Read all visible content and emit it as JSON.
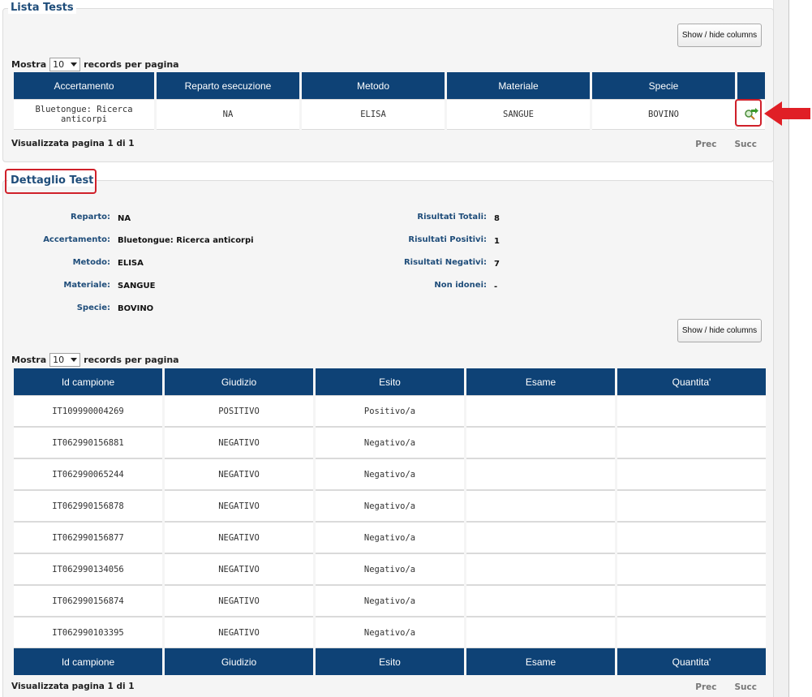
{
  "lista": {
    "title": "Lista Tests",
    "show_hide_label": "Show / hide columns",
    "length": {
      "prefix": "Mostra",
      "value": "10",
      "suffix": "records per pagina"
    },
    "columns": [
      "Accertamento",
      "Reparto esecuzione",
      "Metodo",
      "Materiale",
      "Specie",
      ""
    ],
    "rows": [
      {
        "accertamento": "Bluetongue: Ricerca anticorpi",
        "reparto": "NA",
        "metodo": "ELISA",
        "materiale": "SANGUE",
        "specie": "BOVINO",
        "action_icon": "view-details-icon"
      }
    ],
    "info": "Visualizzata pagina 1 di 1",
    "prev": "Prec",
    "next": "Succ"
  },
  "dettaglio": {
    "title": "Dettaglio Test",
    "fields_left": [
      {
        "label": "Reparto:",
        "value": "NA"
      },
      {
        "label": "Accertamento:",
        "value": "Bluetongue: Ricerca anticorpi"
      },
      {
        "label": "Metodo:",
        "value": "ELISA"
      },
      {
        "label": "Materiale:",
        "value": "SANGUE"
      },
      {
        "label": "Specie:",
        "value": "BOVINO"
      }
    ],
    "fields_right": [
      {
        "label": "Risultati Totali:",
        "value": "8"
      },
      {
        "label": "Risultati Positivi:",
        "value": "1"
      },
      {
        "label": "Risultati Negativi:",
        "value": "7"
      },
      {
        "label": "Non idonei:",
        "value": "-"
      }
    ],
    "show_hide_label": "Show / hide columns",
    "length": {
      "prefix": "Mostra",
      "value": "10",
      "suffix": "records per pagina"
    },
    "columns": [
      "Id campione",
      "Giudizio",
      "Esito",
      "Esame",
      "Quantita'"
    ],
    "rows": [
      {
        "id": "IT109990004269",
        "giudizio": "POSITIVO",
        "esito": "Positivo/a",
        "esame": "",
        "quantita": ""
      },
      {
        "id": "IT062990156881",
        "giudizio": "NEGATIVO",
        "esito": "Negativo/a",
        "esame": "",
        "quantita": ""
      },
      {
        "id": "IT062990065244",
        "giudizio": "NEGATIVO",
        "esito": "Negativo/a",
        "esame": "",
        "quantita": ""
      },
      {
        "id": "IT062990156878",
        "giudizio": "NEGATIVO",
        "esito": "Negativo/a",
        "esame": "",
        "quantita": ""
      },
      {
        "id": "IT062990156877",
        "giudizio": "NEGATIVO",
        "esito": "Negativo/a",
        "esame": "",
        "quantita": ""
      },
      {
        "id": "IT062990134056",
        "giudizio": "NEGATIVO",
        "esito": "Negativo/a",
        "esame": "",
        "quantita": ""
      },
      {
        "id": "IT062990156874",
        "giudizio": "NEGATIVO",
        "esito": "Negativo/a",
        "esame": "",
        "quantita": ""
      },
      {
        "id": "IT062990103395",
        "giudizio": "NEGATIVO",
        "esito": "Negativo/a",
        "esame": "",
        "quantita": ""
      }
    ],
    "info": "Visualizzata pagina 1 di 1",
    "prev": "Prec",
    "next": "Succ"
  },
  "colors": {
    "header_bg": "#0e4276",
    "title_text": "#1f4d7a",
    "highlight": "#d0202a"
  }
}
